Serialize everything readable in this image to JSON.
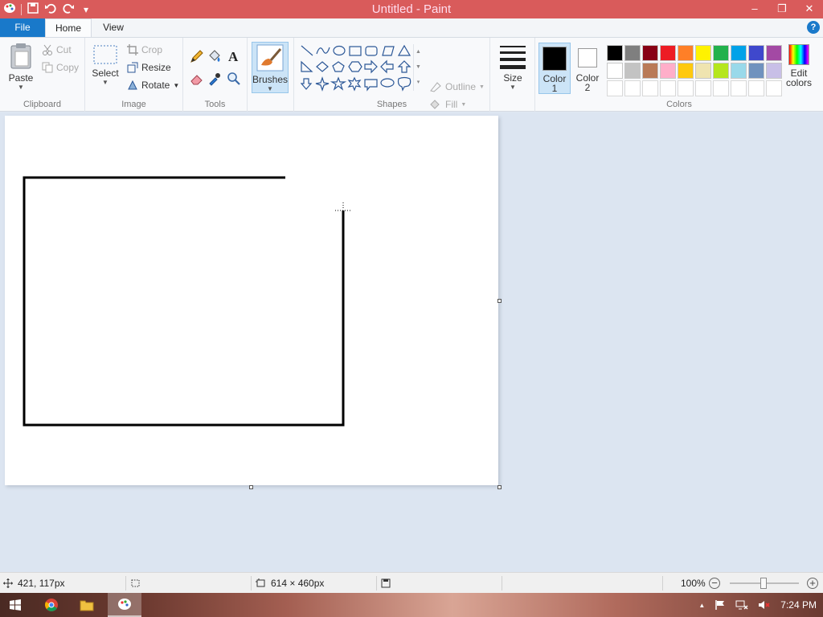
{
  "window": {
    "title": "Untitled - Paint",
    "controls": {
      "minimize": "–",
      "restore": "❐",
      "close": "✕"
    },
    "qat": {
      "dropdown": "▾"
    }
  },
  "tabs": [
    {
      "label": "File"
    },
    {
      "label": "Home"
    },
    {
      "label": "View"
    }
  ],
  "help": "?",
  "ribbon": {
    "clipboard": {
      "group": "Clipboard",
      "paste": "Paste",
      "cut": "Cut",
      "copy": "Copy"
    },
    "image": {
      "group": "Image",
      "select": "Select",
      "crop": "Crop",
      "resize": "Resize",
      "rotate": "Rotate"
    },
    "tools": {
      "group": "Tools"
    },
    "brushes": {
      "label": "Brushes"
    },
    "shapes": {
      "group": "Shapes",
      "outline": "Outline",
      "fill": "Fill"
    },
    "size": {
      "label": "Size"
    },
    "colors": {
      "group": "Colors",
      "color1_label": "Color",
      "color1_num": "1",
      "color2_label": "Color",
      "color2_num": "2",
      "edit_line1": "Edit",
      "edit_line2": "colors",
      "color1_value": "#000000",
      "color2_value": "#ffffff",
      "palette": [
        "#000000",
        "#7f7f7f",
        "#880015",
        "#ed1c24",
        "#ff7f27",
        "#fff200",
        "#22b14c",
        "#00a2e8",
        "#3f48cc",
        "#a349a4",
        "#ffffff",
        "#c3c3c3",
        "#b97a57",
        "#ffaec9",
        "#ffc90e",
        "#efe4b0",
        "#b5e61d",
        "#99d9ea",
        "#7092be",
        "#c8bfe7",
        "#ffffff",
        "#ffffff",
        "#ffffff",
        "#ffffff",
        "#ffffff",
        "#ffffff",
        "#ffffff",
        "#ffffff",
        "#ffffff",
        "#ffffff"
      ]
    }
  },
  "status": {
    "cursor_pos": "421, 117px",
    "canvas_size": "614 × 460px",
    "zoom": "100%"
  },
  "taskbar": {
    "clock": "7:24 PM",
    "tray_arrow": "▲"
  }
}
